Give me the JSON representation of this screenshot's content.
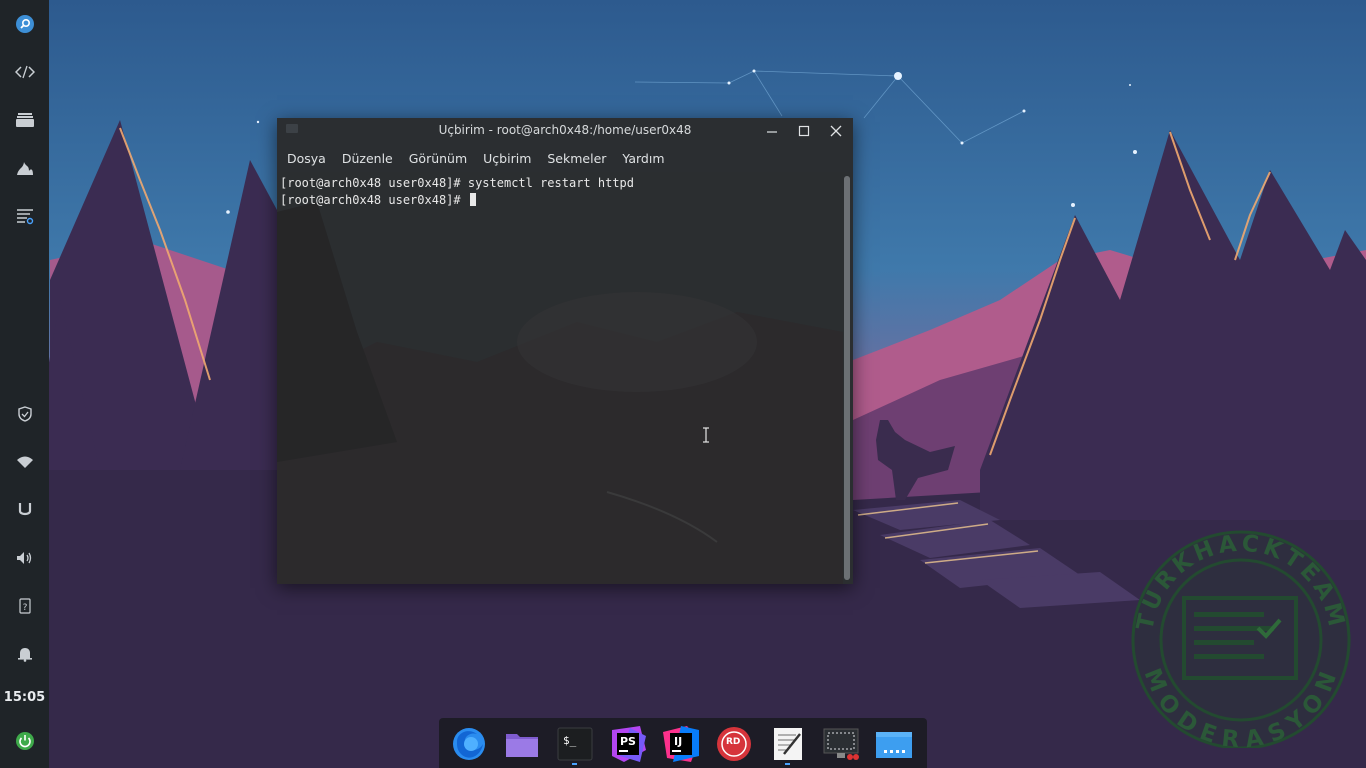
{
  "window": {
    "title": "Uçbirim - root@arch0x48:/home/user0x48",
    "minimize_icon": "minimize-icon",
    "maximize_icon": "maximize-icon",
    "close_icon": "close-icon"
  },
  "menubar": {
    "items": [
      "Dosya",
      "Düzenle",
      "Görünüm",
      "Uçbirim",
      "Sekmeler",
      "Yardım"
    ]
  },
  "terminal": {
    "lines": [
      "[root@arch0x48 user0x48]# systemctl restart httpd",
      "[root@arch0x48 user0x48]# "
    ]
  },
  "left_panel": {
    "top_icons": [
      "search-icon",
      "code-icon",
      "tray-icon",
      "flame-icon",
      "log-icon"
    ],
    "bottom_icons": [
      "shield-icon",
      "wifi-icon",
      "magnet-icon",
      "volume-icon",
      "help-icon",
      "bell-icon"
    ],
    "clock": "15:05",
    "power_icon": "power-icon"
  },
  "dock": {
    "items": [
      {
        "name": "firefox",
        "label": ""
      },
      {
        "name": "files",
        "label": ""
      },
      {
        "name": "terminal",
        "label": "$_"
      },
      {
        "name": "phpstorm",
        "label": "PS"
      },
      {
        "name": "intellij",
        "label": "IJ"
      },
      {
        "name": "another-redis-desktop",
        "label": "RD"
      },
      {
        "name": "text-editor",
        "label": ""
      },
      {
        "name": "screenshot",
        "label": ""
      },
      {
        "name": "desktop",
        "label": ""
      }
    ]
  },
  "watermark": {
    "top_text": "TURKHACKTEAM",
    "bottom_text": "MODERASYON"
  },
  "colors": {
    "panel_bg": "#1f2428",
    "terminal_bg": "#2e3134",
    "sky_top": "#2f5c92",
    "accent": "#4aa3ff",
    "watermark_green": "#1f4a2c"
  }
}
